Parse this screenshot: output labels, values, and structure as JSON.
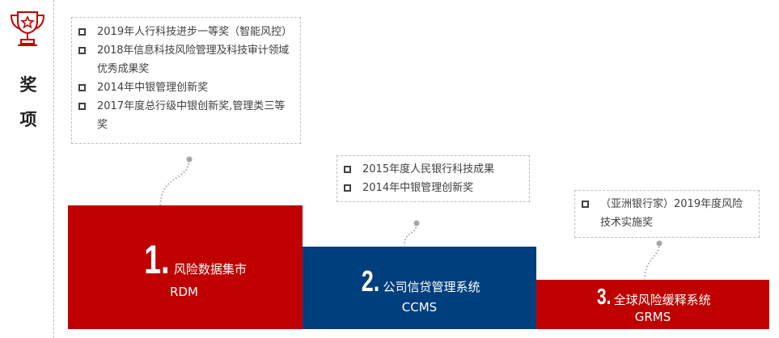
{
  "side": {
    "title_1": "奖",
    "title_2": "项",
    "icon": "trophy-icon",
    "accent": "#c00000"
  },
  "colors": {
    "red": "#c00000",
    "blue": "#003f7d"
  },
  "awards": [
    {
      "items": [
        "2019年人行科技进步一等奖（智能风控）",
        "2018年信息科技风险管理及科技审计领域优秀成果奖",
        "2014年中银管理创新奖",
        "2017年度总行级中银创新奖,管理类三等奖"
      ]
    },
    {
      "items": [
        "2015年度人民银行科技成果",
        "2014年中银管理创新奖"
      ]
    },
    {
      "items": [
        "（亚洲银行家）2019年度风险技术实施奖"
      ]
    }
  ],
  "systems": [
    {
      "number": "1.",
      "name": "风险数据集市",
      "code": "RDM"
    },
    {
      "number": "2.",
      "name": "公司信贷管理系统",
      "code": "CCMS"
    },
    {
      "number": "3.",
      "name": "全球风险缓释系统",
      "code": "GRMS"
    }
  ]
}
